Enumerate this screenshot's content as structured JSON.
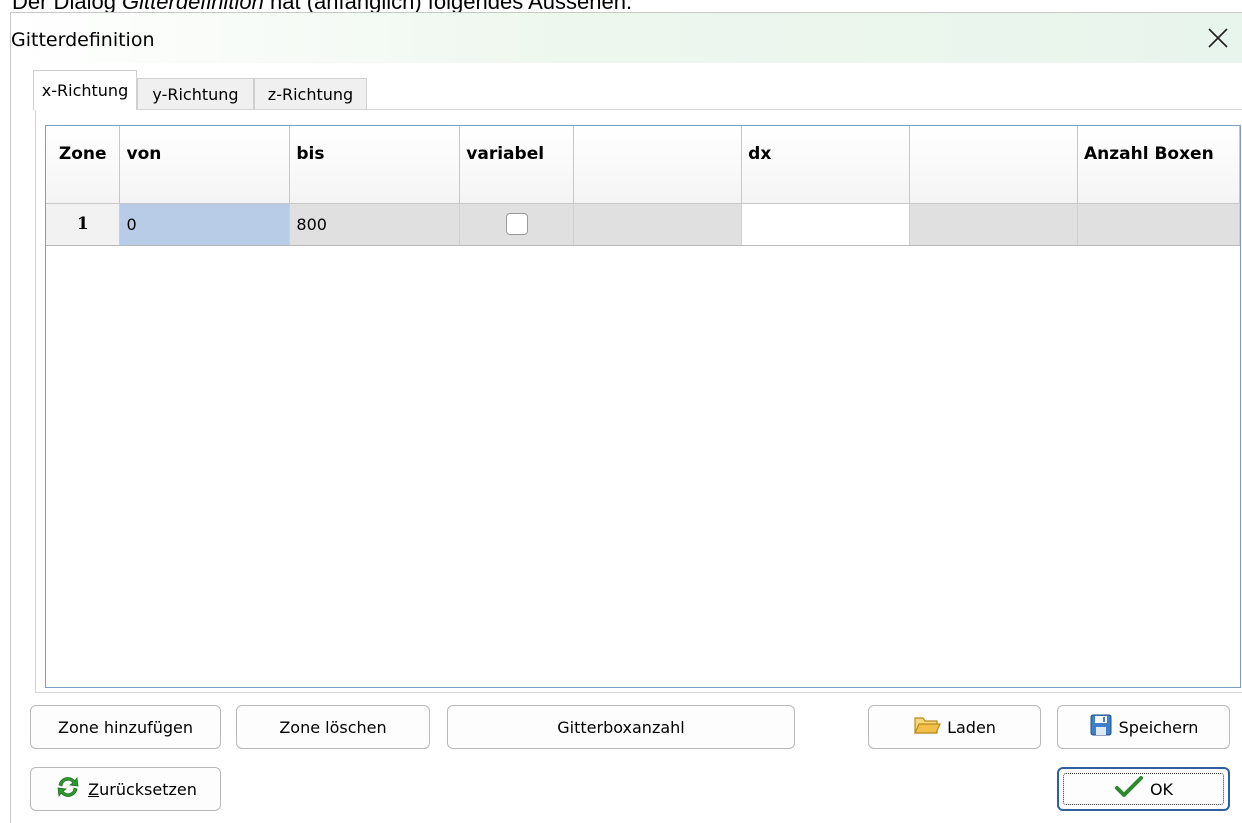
{
  "caption": {
    "before": "Der Dialog ",
    "italic": "Gitterdefinition",
    "after": " hat (anfänglich) folgendes Aussehen."
  },
  "dialog": {
    "title": "Gitterdefinition",
    "close_icon": "close-icon"
  },
  "tabs": [
    {
      "label": "x-Richtung",
      "active": true
    },
    {
      "label": "y-Richtung",
      "active": false
    },
    {
      "label": "z-Richtung",
      "active": false
    }
  ],
  "grid": {
    "columns": [
      "Zone",
      "von",
      "bis",
      "variabel",
      "",
      "dx",
      "",
      "Anzahl Boxen"
    ],
    "rows": [
      {
        "zone": "1",
        "von": "0",
        "bis": "800",
        "variabel": false,
        "dx": "",
        "anzahl": ""
      }
    ]
  },
  "buttons": {
    "zone_add": "Zone hinzufügen",
    "zone_delete": "Zone löschen",
    "gitterboxanzahl": "Gitterboxanzahl",
    "laden": "Laden",
    "speichern": "Speichern",
    "reset_underlined": "Z",
    "reset_rest": "urücksetzen",
    "ok": "OK"
  },
  "icons": {
    "laden": "folder-open-icon",
    "speichern": "floppy-disk-icon",
    "reset": "refresh-icon",
    "ok": "checkmark-icon"
  },
  "colors": {
    "selected_cell": "#b8cce8",
    "ok_border": "#2f5f9e",
    "reset_icon": "#2e9a2e",
    "checkmark": "#2c8a2c",
    "folder": "#f2c04a"
  }
}
